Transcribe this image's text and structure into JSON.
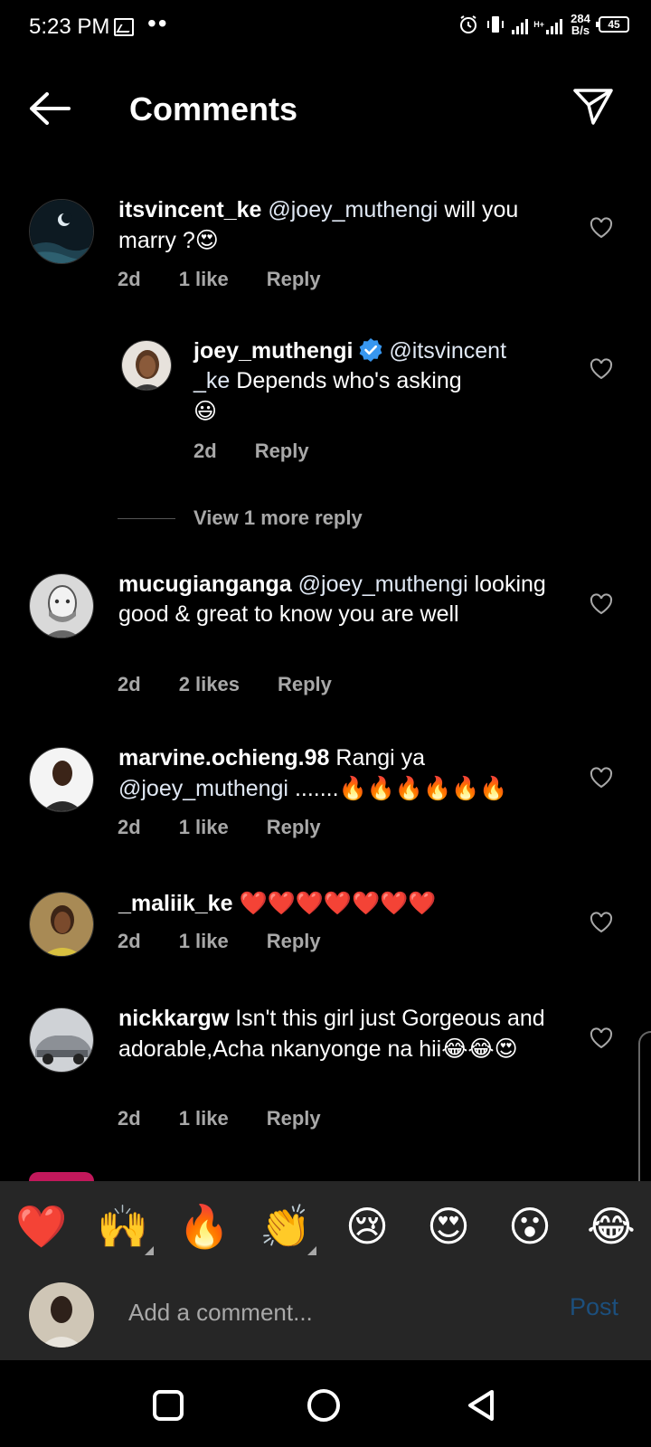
{
  "status_bar": {
    "time": "5:23 PM",
    "dots": "••",
    "net_speed_value": "284",
    "net_speed_unit": "B/s",
    "battery": "45",
    "net_type": "H+"
  },
  "header": {
    "title": "Comments"
  },
  "comments": [
    {
      "username": "itsvincent_ke",
      "mention": "@joey_muthengi",
      "text": " will you marry ?",
      "emoji": "😍",
      "time": "2d",
      "likes": "1 like",
      "reply": "Reply"
    },
    {
      "username": "joey_muthengi",
      "mention": "@itsvincent _ke",
      "text": " Depends who's asking",
      "emoji": "😃",
      "time": "2d",
      "reply": "Reply",
      "verified": true
    },
    {
      "username": "mucugianganga",
      "mention": "@joey_muthengi",
      "text": " looking good & great to know you are well",
      "time": "2d",
      "likes": "2 likes",
      "reply": "Reply"
    },
    {
      "username": "marvine.ochieng.98",
      "text_before": " Rangi ya ",
      "mention": "@joey_muthengi",
      "text": " .......",
      "emoji": "🔥🔥🔥🔥🔥🔥",
      "time": "2d",
      "likes": "1 like",
      "reply": "Reply"
    },
    {
      "username": "_maliik_ke",
      "emoji": "❤️❤️❤️❤️❤️❤️❤️",
      "time": "2d",
      "likes": "1 like",
      "reply": "Reply"
    },
    {
      "username": "nickkargw",
      "text": " Isn't this girl just Gorgeous and adorable,Acha nkanyonge na hii",
      "emoji": "😂😂😍",
      "time": "2d",
      "likes": "1 like",
      "reply": "Reply"
    }
  ],
  "view_more": "View 1 more reply",
  "reactions": [
    "❤️",
    "🙌",
    "🔥",
    "👏",
    "😢",
    "😍",
    "😮",
    "😂"
  ],
  "composer": {
    "placeholder": "Add a comment...",
    "post_label": "Post"
  },
  "colors": {
    "background": "#000000",
    "muted_text": "#a8a8a8",
    "bar_background": "#262626",
    "post_disabled": "#1c4f7d",
    "verified_blue": "#3897f0"
  }
}
